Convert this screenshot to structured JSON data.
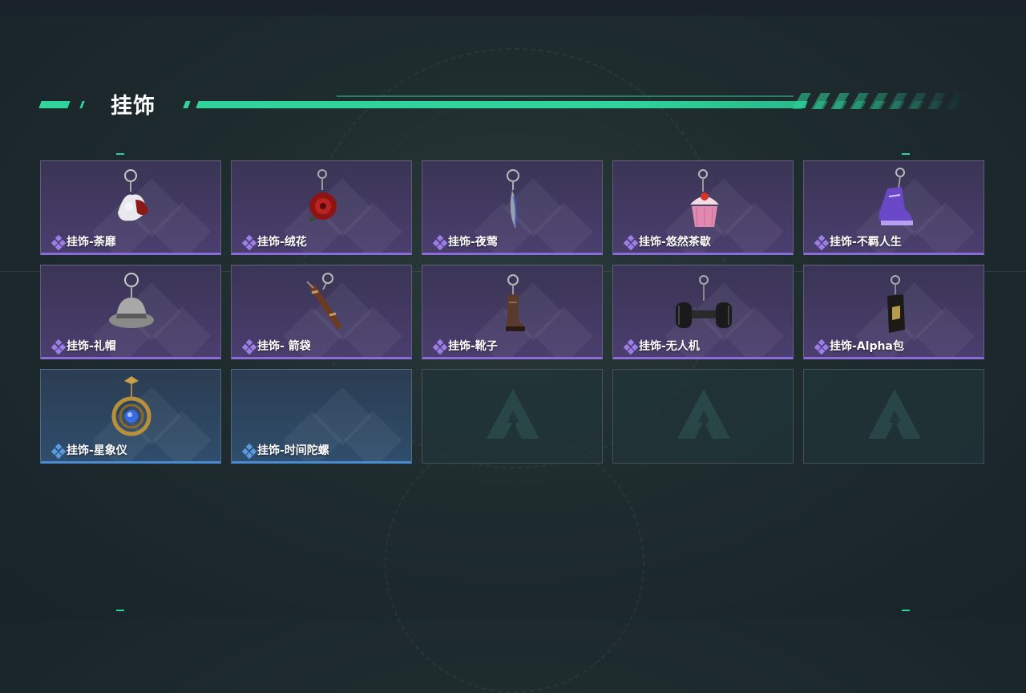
{
  "section": {
    "title": "挂饰"
  },
  "colors": {
    "accent": "#2fd49a",
    "epic_purple": "#8a6bd8",
    "rare_blue": "#4a8ad0"
  },
  "items": [
    {
      "label": "挂饰-荼靡",
      "rarity": "purple",
      "icon": "flower-charm-icon"
    },
    {
      "label": "挂饰-绒花",
      "rarity": "purple",
      "icon": "red-rose-charm-icon"
    },
    {
      "label": "挂饰-夜莺",
      "rarity": "purple",
      "icon": "feather-charm-icon"
    },
    {
      "label": "挂饰-悠然茶歇",
      "rarity": "purple",
      "icon": "cupcake-charm-icon"
    },
    {
      "label": "挂饰-不羁人生",
      "rarity": "purple",
      "icon": "sneaker-charm-icon"
    },
    {
      "label": "挂饰-礼帽",
      "rarity": "purple",
      "icon": "fedora-hat-charm-icon"
    },
    {
      "label": "挂饰- 箭袋",
      "rarity": "purple",
      "icon": "quiver-charm-icon"
    },
    {
      "label": "挂饰-靴子",
      "rarity": "purple",
      "icon": "boot-charm-icon"
    },
    {
      "label": "挂饰-无人机",
      "rarity": "purple",
      "icon": "drone-charm-icon"
    },
    {
      "label": "挂饰-Alpha包",
      "rarity": "purple",
      "icon": "alpha-bag-charm-icon"
    },
    {
      "label": "挂饰-星象仪",
      "rarity": "blue",
      "icon": "astrolabe-charm-icon"
    },
    {
      "label": "挂饰-时间陀螺",
      "rarity": "blue",
      "icon": "time-gyro-charm-icon"
    }
  ],
  "empty_slots": 3
}
